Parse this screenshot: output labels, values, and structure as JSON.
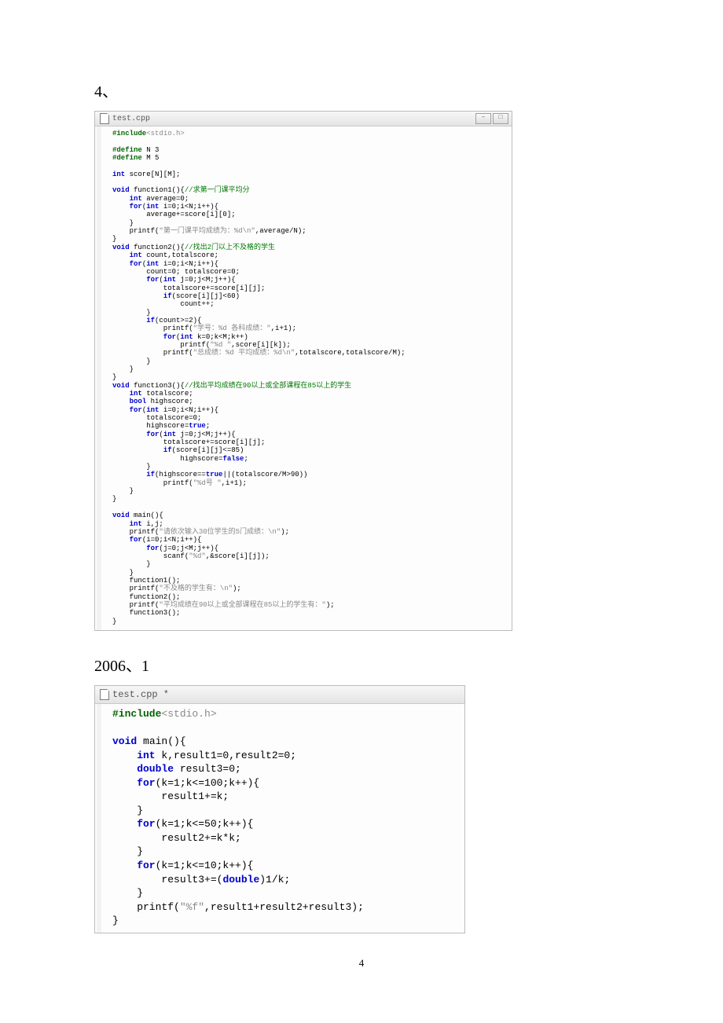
{
  "headings": {
    "h1": "4、",
    "h2": "2006、1"
  },
  "window1": {
    "tab_title": "test.cpp",
    "min_label": "–",
    "max_label": "□",
    "close_label": "×"
  },
  "window2": {
    "tab_title": "test.cpp *"
  },
  "code1": {
    "l01a": "#include",
    "l01b": "<stdio.h>",
    "l02": "",
    "l03a": "#define",
    "l03b": " N 3",
    "l04a": "#define",
    "l04b": " M 5",
    "l05": "",
    "l06a": "int",
    "l06b": " score[N][M];",
    "l07": "",
    "l08a": "void",
    "l08b": " function1(){",
    "l08c": "//求第一门课平均分",
    "l09a": "    int",
    "l09b": " average=0;",
    "l10a": "    for",
    "l10b": "(",
    "l10c": "int",
    "l10d": " i=0;i<N;i++){",
    "l11": "        average+=score[i][0];",
    "l12": "    }",
    "l13a": "    printf(",
    "l13b": "\"第一门课平均成绩为：%d\\n\"",
    "l13c": ",average/N);",
    "l14": "}",
    "l15a": "void",
    "l15b": " function2(){",
    "l15c": "//找出2门以上不及格的学生",
    "l16a": "    int",
    "l16b": " count,totalscore;",
    "l17a": "    for",
    "l17b": "(",
    "l17c": "int",
    "l17d": " i=0;i<N;i++){",
    "l18": "        count=0; totalscore=0;",
    "l19a": "        for",
    "l19b": "(",
    "l19c": "int",
    "l19d": " j=0;j<M;j++){",
    "l20": "            totalscore+=score[i][j];",
    "l21a": "            if",
    "l21b": "(score[i][j]<60)",
    "l22": "                count++;",
    "l23": "        }",
    "l24a": "        if",
    "l24b": "(count>=2){",
    "l25a": "            printf(",
    "l25b": "\"学号：%d 各科成绩：\"",
    "l25c": ",i+1);",
    "l26a": "            for",
    "l26b": "(",
    "l26c": "int",
    "l26d": " k=0;k<M;k++)",
    "l27a": "                printf(",
    "l27b": "\"%d \"",
    "l27c": ",score[i][k]);",
    "l28a": "            printf(",
    "l28b": "\"总成绩：%d 平均成绩：%d\\n\"",
    "l28c": ",totalscore,totalscore/M);",
    "l29": "        }",
    "l30": "    }",
    "l31": "}",
    "l32a": "void",
    "l32b": " function3(){",
    "l32c": "//找出平均成绩在90以上或全部课程在85以上的学生",
    "l33a": "    int",
    "l33b": " totalscore;",
    "l34a": "    bool",
    "l34b": " highscore;",
    "l35a": "    for",
    "l35b": "(",
    "l35c": "int",
    "l35d": " i=0;i<N;i++){",
    "l36": "        totalscore=0;",
    "l37a": "        highscore=",
    "l37b": "true",
    "l37c": ";",
    "l38a": "        for",
    "l38b": "(",
    "l38c": "int",
    "l38d": " j=0;j<M;j++){",
    "l39": "            totalscore+=score[i][j];",
    "l40a": "            if",
    "l40b": "(score[i][j]<=85)",
    "l41a": "                highscore=",
    "l41b": "false",
    "l41c": ";",
    "l42": "        }",
    "l43a": "        if",
    "l43b": "(highscore==",
    "l43c": "true",
    "l43d": "||(totalscore/M>90))",
    "l44a": "            printf(",
    "l44b": "\"%d号 \"",
    "l44c": ",i+1);",
    "l45": "    }",
    "l46": "}",
    "l47": "",
    "l48a": "void",
    "l48b": " main(){",
    "l49a": "    int",
    "l49b": " i,j;",
    "l50a": "    printf(",
    "l50b": "\"请依次输入30位学生的5门成绩：\\n\"",
    "l50c": ");",
    "l51a": "    for",
    "l51b": "(i=0;i<N;i++){",
    "l52a": "        for",
    "l52b": "(j=0;j<M;j++){",
    "l53a": "            scanf(",
    "l53b": "\"%d\"",
    "l53c": ",&score[i][j]);",
    "l54": "        }",
    "l55": "    }",
    "l56": "    function1();",
    "l57a": "    printf(",
    "l57b": "\"不及格的学生有：\\n\"",
    "l57c": ");",
    "l58": "    function2();",
    "l59a": "    printf(",
    "l59b": "\"平均成绩在90以上或全部课程在85以上的学生有：\"",
    "l59c": ");",
    "l60": "    function3();",
    "l61": "}"
  },
  "code2": {
    "l01a": "#include",
    "l01b": "<stdio.h>",
    "l02": "",
    "l03a": "void",
    "l03b": " main(){",
    "l04a": "    int",
    "l04b": " k,result1=0,result2=0;",
    "l05a": "    double",
    "l05b": " result3=0;",
    "l06a": "    for",
    "l06b": "(k=1;k<=100;k++){",
    "l07": "        result1+=k;",
    "l08": "    }",
    "l09a": "    for",
    "l09b": "(k=1;k<=50;k++){",
    "l10": "        result2+=k*k;",
    "l11": "    }",
    "l12a": "    for",
    "l12b": "(k=1;k<=10;k++){",
    "l13a": "        result3+=(",
    "l13b": "double",
    "l13c": ")1/k;",
    "l14": "    }",
    "l15a": "    printf(",
    "l15b": "\"%f\"",
    "l15c": ",result1+result2+result3);",
    "l16": "}"
  },
  "page_number": "4"
}
